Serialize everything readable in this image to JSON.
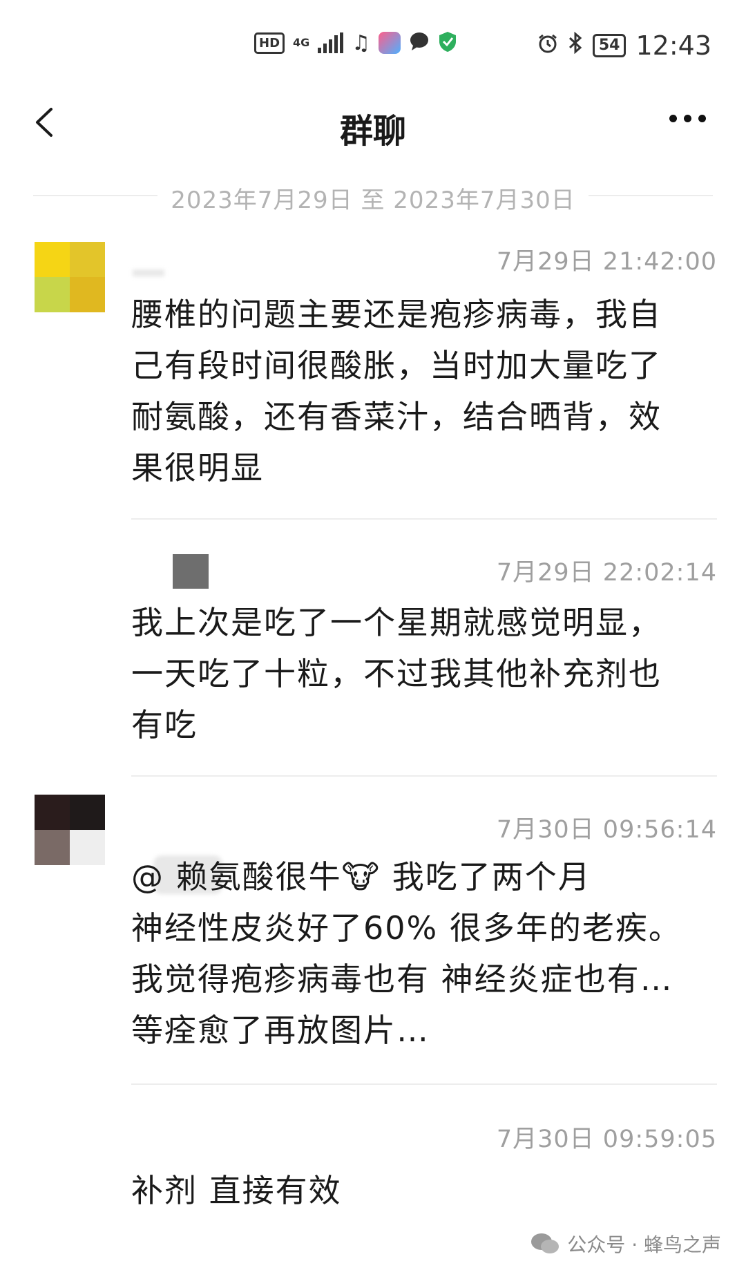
{
  "status_bar": {
    "hd_label": "HD",
    "network_label": "4G",
    "battery": "54",
    "time": "12:43",
    "icons": [
      "signal-icon",
      "music-icon",
      "app-icon",
      "message-bubble-icon",
      "shield-check-icon",
      "alarm-icon",
      "bluetooth-icon"
    ]
  },
  "header": {
    "title": "群聊",
    "back_icon": "chevron-left-icon",
    "more_icon": "more-dots-icon"
  },
  "date_range": "2023年7月29日 至 2023年7月30日",
  "messages": [
    {
      "time": "7月29日 21:42:00",
      "text_lines": [
        "腰椎的问题主要还是疱疹病毒，我自",
        "己有段时间很酸胀，当时加大量吃了",
        "耐氨酸，还有香菜汁，结合晒背，效",
        "果很明显"
      ]
    },
    {
      "time": "7月29日 22:02:14",
      "text_lines": [
        "我上次是吃了一个星期就感觉明显，",
        "一天吃了十粒，不过我其他补充剂也",
        "有吃"
      ]
    },
    {
      "time": "7月30日 09:56:14",
      "text_lines": [
        "@         赖氨酸很牛🐮 我吃了两个月",
        "神经性皮炎好了60% 很多年的老疾。",
        "我觉得疱疹病毒也有 神经炎症也有…",
        "等痊愈了再放图片…"
      ]
    },
    {
      "time": "7月30日 09:59:05",
      "text_lines": [
        "补剂 直接有效"
      ]
    }
  ],
  "watermark": "公众号 · 蜂鸟之声",
  "colors": {
    "timestamp": "#9f9f9f",
    "date_range": "#b3b3b3",
    "text": "#1a1a1a"
  }
}
